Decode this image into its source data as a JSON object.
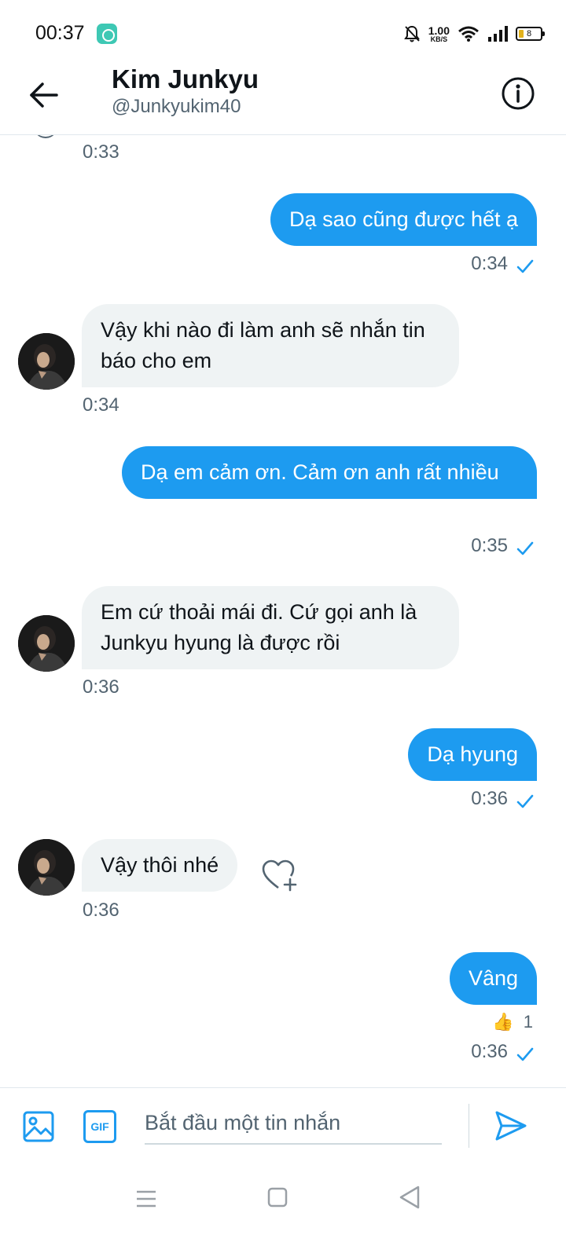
{
  "status_bar": {
    "time": "00:37",
    "net_speed_value": "1.00",
    "net_speed_unit": "KB/S",
    "battery": "8",
    "icons": [
      "app-notification-icon",
      "mute-bell-icon",
      "wifi-icon",
      "cellular-signal-icon",
      "battery-icon"
    ]
  },
  "header": {
    "name": "Kim Junkyu",
    "handle": "@Junkyukim40",
    "back_icon": "arrow-left-icon",
    "info_icon": "info-circle-icon"
  },
  "messages": [
    {
      "from": "them",
      "text": "",
      "time": "0:33"
    },
    {
      "from": "me",
      "text": "Dạ sao cũng được hết ạ",
      "time": "0:34",
      "seen": true
    },
    {
      "from": "them",
      "text": "Vậy khi nào đi làm anh sẽ nhắn tin báo cho em",
      "time": "0:34"
    },
    {
      "from": "me",
      "text": "Dạ em cảm ơn. Cảm ơn anh rất nhiều",
      "time": "0:35",
      "seen": true
    },
    {
      "from": "them",
      "text": "Em cứ thoải mái đi. Cứ gọi anh là Junkyu hyung là được rồi",
      "time": "0:36"
    },
    {
      "from": "me",
      "text": "Dạ hyung",
      "time": "0:36",
      "seen": true
    },
    {
      "from": "them",
      "text": "Vậy thôi nhé",
      "time": "0:36",
      "react_icon": "heart-plus-icon"
    },
    {
      "from": "me",
      "text": "Vâng",
      "time": "0:36",
      "seen": true,
      "reaction": {
        "emoji": "👍",
        "count": "1"
      }
    }
  ],
  "composer": {
    "placeholder": "Bắt đầu một tin nhắn",
    "gif_label": "GIF",
    "icons": [
      "image-icon",
      "gif-icon",
      "send-icon"
    ]
  },
  "colors": {
    "accent": "#1d9bf0",
    "incoming_bubble": "#eff3f4",
    "secondary_text": "#536471"
  }
}
